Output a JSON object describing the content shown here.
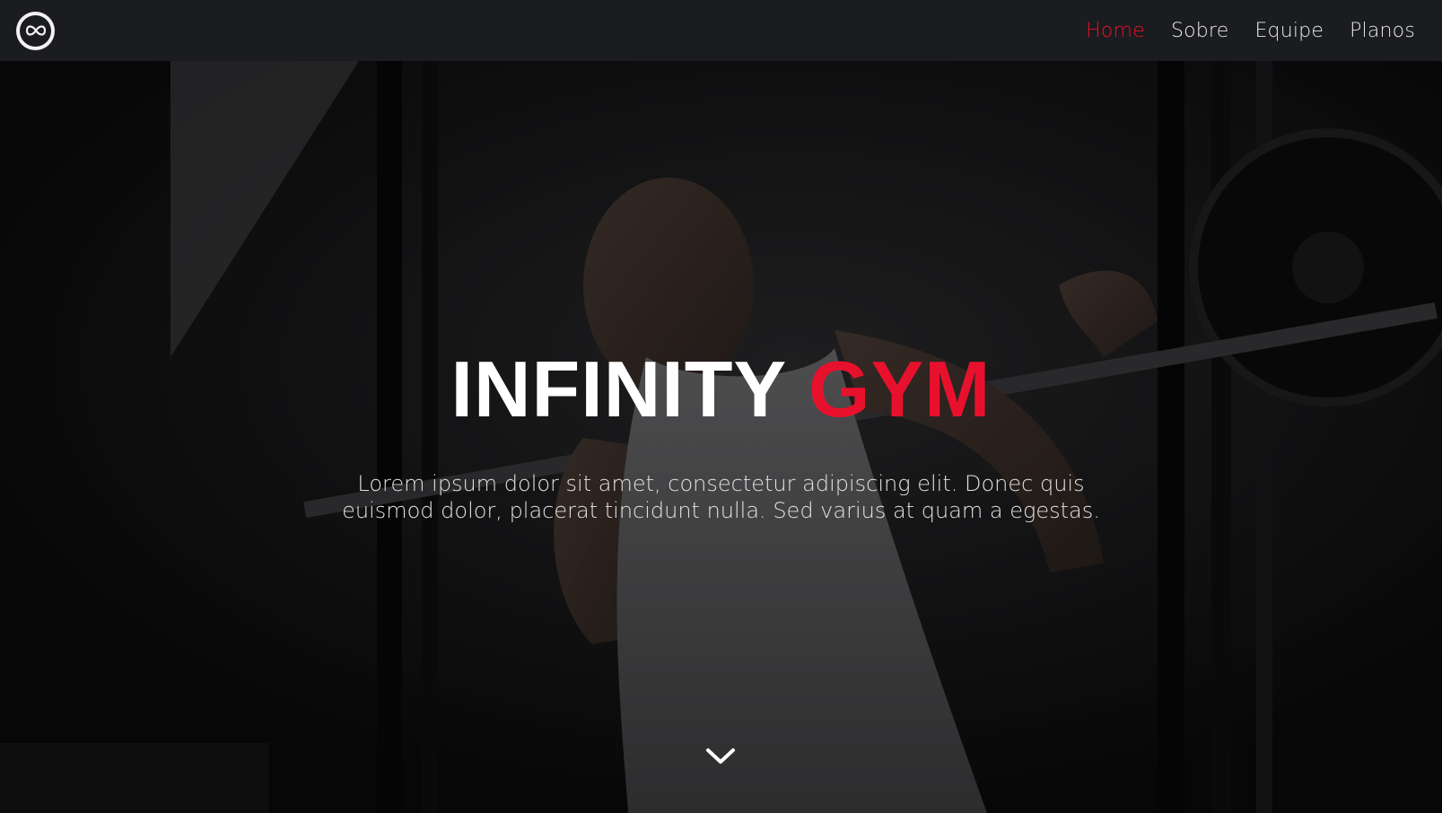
{
  "brand": {
    "logo_icon": "infinity-logo-icon"
  },
  "nav": {
    "items": [
      {
        "label": "Home",
        "active": true
      },
      {
        "label": "Sobre",
        "active": false
      },
      {
        "label": "Equipe",
        "active": false
      },
      {
        "label": "Planos",
        "active": false
      }
    ]
  },
  "hero": {
    "title_main": "INFINITY",
    "title_accent": "GYM",
    "description": "Lorem ipsum dolor sit amet, consectetur adipiscing elit. Donec quis euismod dolor, placerat tincidunt nulla. Sed varius at quam a egestas.",
    "scroll_icon": "chevron-down-icon"
  },
  "colors": {
    "accent": "#e8112d",
    "navbar_bg": "#1b1c1f",
    "text": "#ffffff"
  }
}
